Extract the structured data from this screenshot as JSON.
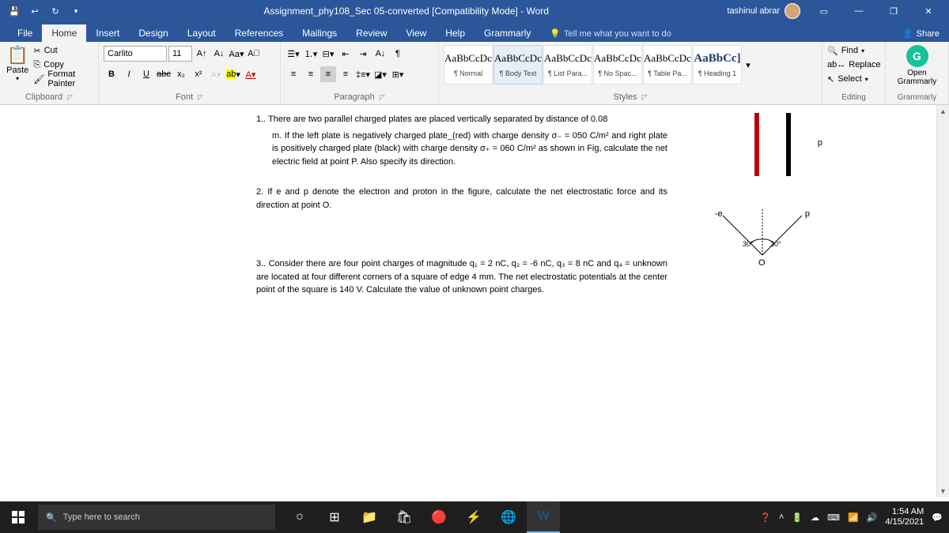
{
  "titlebar": {
    "title": "Assignment_phy108_Sec 05-converted [Compatibility Mode] - Word",
    "user": "tashinul abrar"
  },
  "tabs": {
    "file": "File",
    "home": "Home",
    "insert": "Insert",
    "design": "Design",
    "layout": "Layout",
    "references": "References",
    "mailings": "Mailings",
    "review": "Review",
    "view": "View",
    "help": "Help",
    "grammarly": "Grammarly",
    "tellme": "Tell me what you want to do",
    "share": "Share"
  },
  "clipboard": {
    "paste": "Paste",
    "cut": "Cut",
    "copy": "Copy",
    "format_painter": "Format Painter",
    "label": "Clipboard"
  },
  "font": {
    "name": "Carlito",
    "size": "11",
    "label": "Font"
  },
  "paragraph": {
    "label": "Paragraph"
  },
  "styles": {
    "items": [
      {
        "prev": "AaBbCcDc",
        "name": "¶ Normal"
      },
      {
        "prev": "AaBbCcDc",
        "name": "¶ Body Text"
      },
      {
        "prev": "AaBbCcDc",
        "name": "¶ List Para..."
      },
      {
        "prev": "AaBbCcDc",
        "name": "¶ No Spac..."
      },
      {
        "prev": "AaBbCcDc",
        "name": "¶ Table Pa..."
      },
      {
        "prev": "AaBbCc]",
        "name": "¶ Heading 1"
      }
    ],
    "label": "Styles"
  },
  "editing": {
    "find": "Find",
    "replace": "Replace",
    "select": "Select",
    "label": "Editing"
  },
  "grammarly_panel": {
    "open": "Open Grammarly",
    "label": "Grammarly"
  },
  "document": {
    "q1_a": "1.. There are two parallel charged plates are placed vertically separated by distance of 0.08",
    "q1_b": "m. If the left plate is negatively charged plate_(red) with charge density σ₋ = 050 C/m² and right plate is positively charged plate (black) with charge density σ₊ = 060 C/m² as shown in Fig, calculate the net electric field at point P. Also specify its direction.",
    "q2": "2. If e and p denote the electron and proton in the figure, calculate the net electrostatic force and its direction at point O.",
    "q3": "3.. Consider there are four point charges of magnitude q₁ = 2 nC, q₂ = -6 nC, q₃ = 8 nC and q₄ = unknown are located at four different corners of a square of edge 4 mm. The net electrostatic potentials at the center point of the square is 140 V. Calculate the value of unknown point charges.",
    "fig1_p": "p",
    "fig2_e": "-e",
    "fig2_p": "p",
    "fig2_o": "O",
    "fig2_ang1": "30°",
    "fig2_ang2": "30°"
  },
  "taskbar": {
    "search_placeholder": "Type here to search",
    "time": "1:54 AM",
    "date": "4/15/2021"
  }
}
